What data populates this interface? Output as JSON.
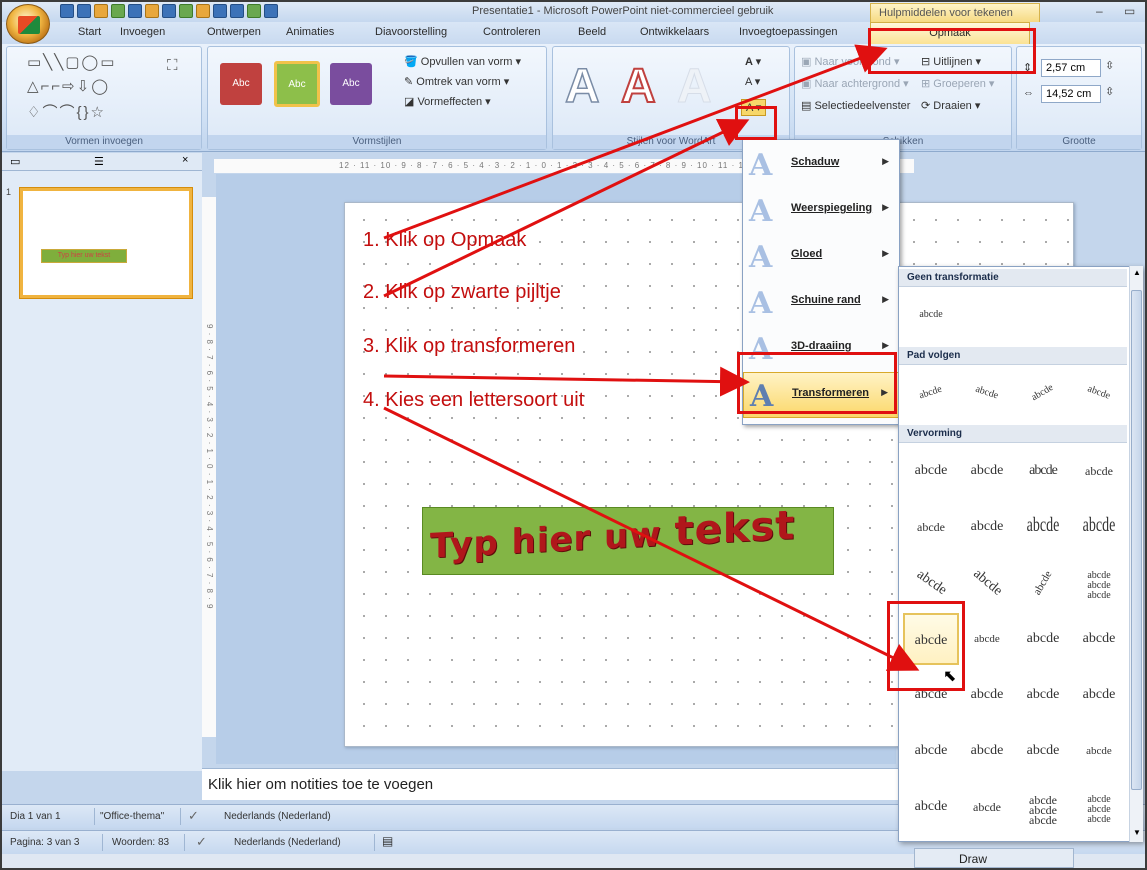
{
  "window": {
    "title": "Presentatie1 - Microsoft PowerPoint niet-commercieel gebruik",
    "contextual_group": "Hulpmiddelen voor tekenen"
  },
  "tabs": [
    "Start",
    "Invoegen",
    "Ontwerpen",
    "Animaties",
    "Diavoorstelling",
    "Controleren",
    "Beeld",
    "Ontwikkelaars",
    "Invoegtoepassingen",
    "Opmaak"
  ],
  "ribbon": {
    "groups": {
      "shapes": "Vormen invoegen",
      "styles": "Vormstijlen",
      "wordart": "Stijlen voor WordArt",
      "arrange": "Schikken",
      "size": "Grootte"
    },
    "style_swatches": [
      "Abc",
      "Abc",
      "Abc"
    ],
    "shape_fill": "Opvullen van vorm",
    "shape_outline": "Omtrek van vorm",
    "shape_effects": "Vormeffecten",
    "bring_forward": "Naar voorgrond",
    "send_backward": "Naar achtergrond",
    "selection_pane": "Selectiedeelvenster",
    "align": "Uitlijnen",
    "group": "Groeperen",
    "rotate": "Draaien",
    "height": "2,57 cm",
    "width": "14,52 cm"
  },
  "slide_panel": {
    "slide_number": "1",
    "thumbnail_text": "Typ hier uw tekst"
  },
  "rulers": {
    "horizontal": "12 · 11 · 10 · 9 · 8 · 7 · 6 · 5 · 4 · 3 · 2 · 1 · 0 · 1 · 2 · 3 · 4 · 5 · 6 · 7 · 8 · 9 · 10 · 11 · 12",
    "vertical": "9 · 8 · 7 · 6 · 5 · 4 · 3 · 2 · 1 · 0 · 1 · 2 · 3 · 4 · 5 · 6 · 7 · 8 · 9"
  },
  "slide": {
    "steps": [
      "1. Klik op Opmaak",
      "2. Klik op zwarte pijltje",
      "3. Klik op transformeren",
      "4. Kies een lettersoort uit"
    ],
    "wordart": [
      "Typ",
      "hier",
      "uw",
      "tekst"
    ]
  },
  "notes_placeholder": "Klik hier om notities toe te voegen",
  "status": {
    "slide": "Dia 1 van 1",
    "theme": "\"Office-thema\"",
    "language": "Nederlands (Nederland)",
    "page": "Pagina: 3 van 3",
    "words": "Woorden: 83",
    "language2": "Nederlands (Nederland)"
  },
  "effects_menu": {
    "items": [
      "Schaduw",
      "Weerspiegeling",
      "Gloed",
      "Schuine rand",
      "3D-draaiing",
      "Transformeren"
    ]
  },
  "gallery": {
    "sections": [
      "Geen transformatie",
      "Pad volgen",
      "Vervorming"
    ],
    "sample": "abcde",
    "stack": [
      "abcde",
      "abcde",
      "abcde"
    ]
  },
  "taskbar": {
    "draw": "Draw"
  },
  "colors": {
    "annotation_red": "#e01010",
    "step_text": "#c30e0e",
    "wordart_fill": "#b0171b",
    "textbox_fill": "#83b545",
    "highlight": "#fbd86a"
  }
}
